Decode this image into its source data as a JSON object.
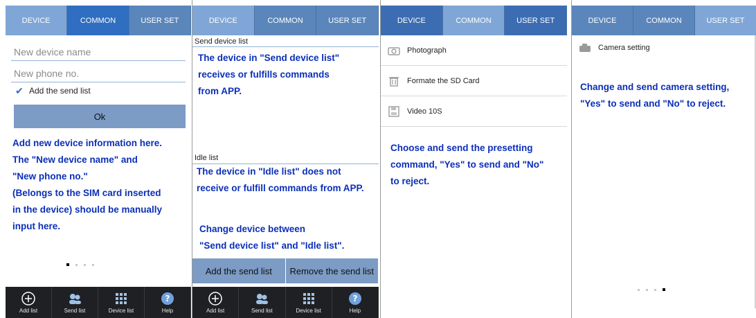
{
  "colors": {
    "tab_bg": "#5b86bb",
    "tab_active": "#2f6ec1",
    "accent_text": "#0b2fb8",
    "button_bg": "#7c9bc5",
    "bottom_bar": "#1f2023"
  },
  "tabs": [
    "DEVICE",
    "COMMON",
    "USER SET"
  ],
  "panel1": {
    "device_name_placeholder": "New device name",
    "phone_placeholder": "New phone no.",
    "add_send_list_label": "Add the send list",
    "ok_label": "Ok",
    "help_lines": [
      "Add new device information here.",
      " The \"New device name\" and",
      "\"New phone no.\"",
      "(Belongs to the SIM card inserted",
      "in the device) should be manually",
      "input here."
    ]
  },
  "panel2": {
    "send_list_header": "Send device list",
    "send_help": [
      "The device in \"Send device list\"",
      " receives or fulfills commands",
      "from APP."
    ],
    "idle_header": "Idle list",
    "idle_help": [
      "The device in \"Idle list\" does not",
      "receive or fulfill commands from APP."
    ],
    "change_help": [
      "Change device between",
      "\"Send device list\" and \"Idle list\"."
    ],
    "add_btn": "Add the send list",
    "remove_btn": "Remove the send list"
  },
  "panel3": {
    "items": [
      {
        "label": "Photograph",
        "icon": "camera-icon"
      },
      {
        "label": "Formate the SD Card",
        "icon": "trash-icon"
      },
      {
        "label": "Video 10S",
        "icon": "save-icon"
      }
    ],
    "help": [
      "Choose and send the presetting",
      "command, \"Yes\" to send and \"No\"",
      "to reject."
    ]
  },
  "panel4": {
    "camera_setting_label": "Camera setting",
    "help": [
      "Change and send camera setting,",
      "\"Yes\" to send and \"No\" to reject."
    ]
  },
  "bottom_nav": [
    "Add list",
    "Send list",
    "Device list",
    "Help"
  ]
}
